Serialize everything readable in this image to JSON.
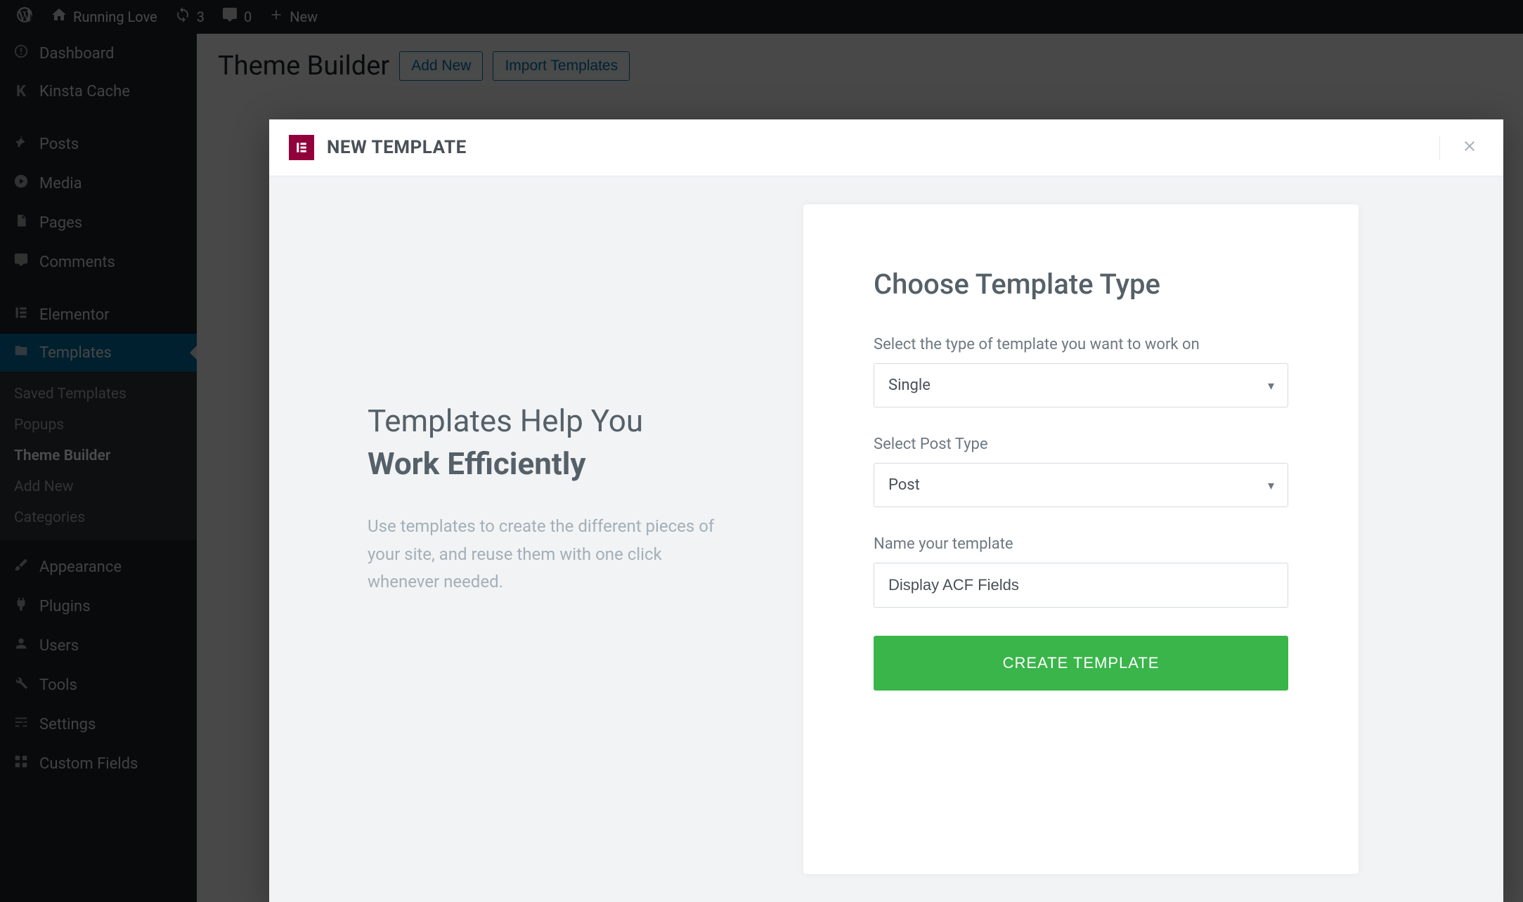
{
  "topbar": {
    "site_name": "Running Love",
    "updates_count": "3",
    "comments_count": "0",
    "new_label": "New"
  },
  "sidebar": {
    "items": [
      {
        "label": "Dashboard",
        "icon": "dashboard-icon"
      },
      {
        "label": "Kinsta Cache",
        "icon": "kinsta-icon"
      },
      {
        "label": "Posts",
        "icon": "pin-icon"
      },
      {
        "label": "Media",
        "icon": "media-icon"
      },
      {
        "label": "Pages",
        "icon": "page-icon"
      },
      {
        "label": "Comments",
        "icon": "comment-icon"
      },
      {
        "label": "Elementor",
        "icon": "elementor-icon"
      },
      {
        "label": "Templates",
        "icon": "folder-icon"
      },
      {
        "label": "Appearance",
        "icon": "brush-icon"
      },
      {
        "label": "Plugins",
        "icon": "plug-icon"
      },
      {
        "label": "Users",
        "icon": "user-icon"
      },
      {
        "label": "Tools",
        "icon": "wrench-icon"
      },
      {
        "label": "Settings",
        "icon": "sliders-icon"
      },
      {
        "label": "Custom Fields",
        "icon": "grid-icon"
      }
    ],
    "sub": [
      "Saved Templates",
      "Popups",
      "Theme Builder",
      "Add New",
      "Categories"
    ]
  },
  "content": {
    "page_title": "Theme Builder",
    "add_new_label": "Add New",
    "import_label": "Import Templates"
  },
  "modal": {
    "title": "NEW TEMPLATE",
    "headline_1": "Templates Help You",
    "headline_2": "Work Efficiently",
    "desc": "Use templates to create the different pieces of your site, and reuse them with one click whenever needed.",
    "form_title": "Choose Template Type",
    "type_label": "Select the type of template you want to work on",
    "type_value": "Single",
    "posttype_label": "Select Post Type",
    "posttype_value": "Post",
    "name_label": "Name your template",
    "name_value": "Display ACF Fields",
    "create_label": "CREATE TEMPLATE"
  }
}
